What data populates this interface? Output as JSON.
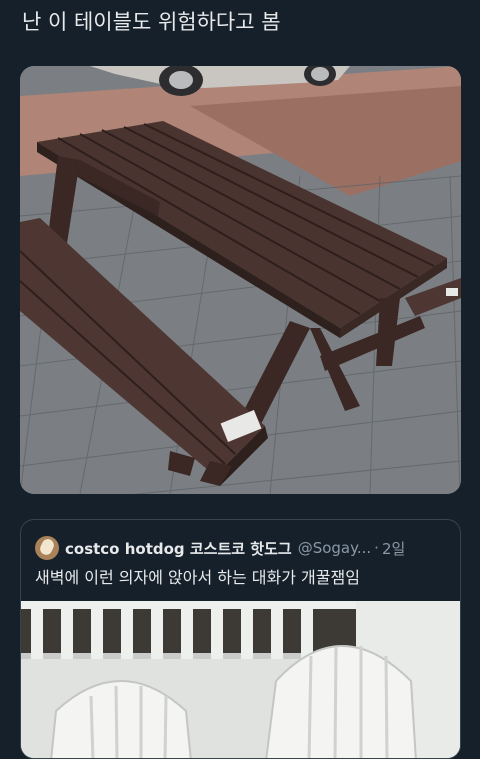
{
  "post": {
    "text": "난 이 테이블도 위험하다고 봄",
    "image_subject": "wooden-picnic-table-photo"
  },
  "quote": {
    "display_name": "costco hotdog 코스트코 핫도그",
    "handle": "@Sogay...",
    "separator": "·",
    "time": "2일",
    "text": "새벽에 이런 의자에 앉아서 하는 대화가 개꿀잼임",
    "image_subject": "white-plastic-chairs-photo"
  },
  "colors": {
    "background": "#15202b",
    "primary_text": "#e7e9ea",
    "secondary_text": "#8b98a5",
    "border": "#38444d"
  }
}
